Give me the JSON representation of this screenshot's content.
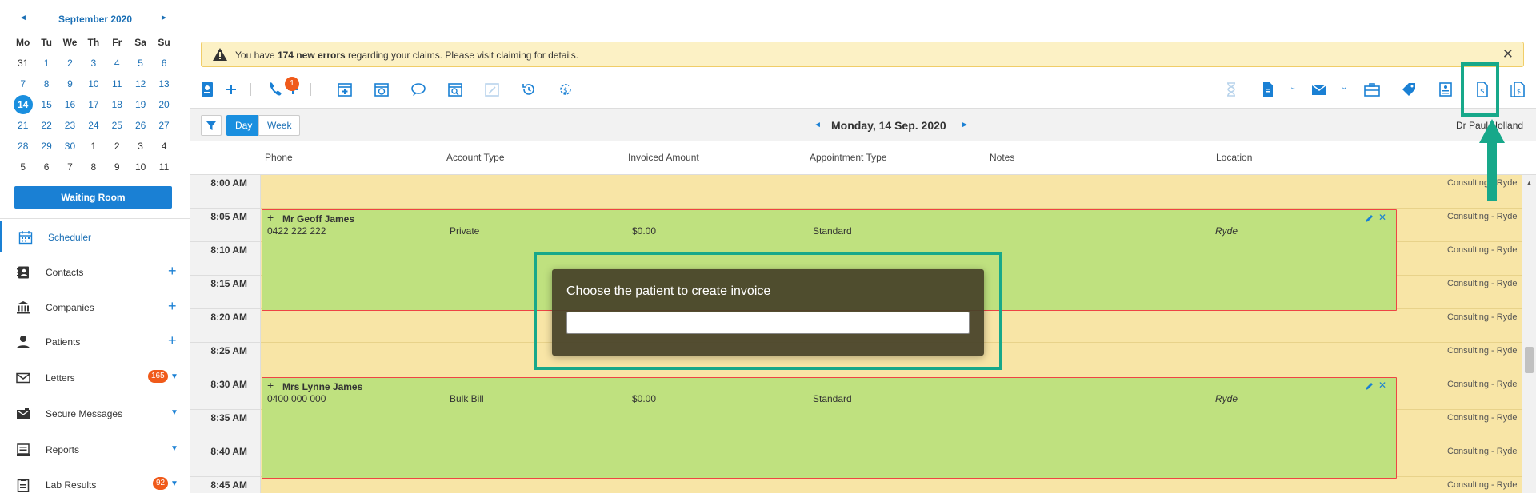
{
  "calendar": {
    "month_label": "September 2020",
    "prev": "◄",
    "next": "►",
    "weekdays": [
      "Mo",
      "Tu",
      "We",
      "Th",
      "Fr",
      "Sa",
      "Su"
    ],
    "weeks": [
      [
        "31",
        "1",
        "2",
        "3",
        "4",
        "5",
        "6"
      ],
      [
        "7",
        "8",
        "9",
        "10",
        "11",
        "12",
        "13"
      ],
      [
        "14",
        "15",
        "16",
        "17",
        "18",
        "19",
        "20"
      ],
      [
        "21",
        "22",
        "23",
        "24",
        "25",
        "26",
        "27"
      ],
      [
        "28",
        "29",
        "30",
        "1",
        "2",
        "3",
        "4"
      ],
      [
        "5",
        "6",
        "7",
        "8",
        "9",
        "10",
        "11"
      ]
    ],
    "selected_day": "14"
  },
  "waiting_room_label": "Waiting Room",
  "nav": [
    {
      "label": "Scheduler",
      "icon": "calendar-icon"
    },
    {
      "label": "Contacts",
      "icon": "contacts-icon",
      "plus": "+"
    },
    {
      "label": "Companies",
      "icon": "bank-icon",
      "plus": "+"
    },
    {
      "label": "Patients",
      "icon": "person-icon",
      "plus": "+"
    },
    {
      "label": "Letters",
      "icon": "envelope-icon",
      "badge": "165"
    },
    {
      "label": "Secure Messages",
      "icon": "secure-mail-icon"
    },
    {
      "label": "Reports",
      "icon": "reports-icon"
    },
    {
      "label": "Lab Results",
      "icon": "clipboard-icon",
      "badge": "92"
    }
  ],
  "alert": {
    "prefix": "You have ",
    "count_text": "174 new errors",
    "suffix": " regarding your claims. Please visit claiming for details.",
    "close": "✕"
  },
  "toolbar": {
    "phone_badge": "1",
    "add_plus": "+"
  },
  "day_header": {
    "day_label": "Day",
    "week_label": "Week",
    "date_title": "Monday, 14 Sep. 2020",
    "prev": "◄",
    "next": "►",
    "doctor": "Dr Paul Holland"
  },
  "columns": [
    "Phone",
    "Account Type",
    "Invoiced Amount",
    "Appointment Type",
    "Notes",
    "Location"
  ],
  "times": [
    "8:00 AM",
    "8:05 AM",
    "8:10 AM",
    "8:15 AM",
    "8:20 AM",
    "8:25 AM",
    "8:30 AM",
    "8:35 AM",
    "8:40 AM",
    "8:45 AM"
  ],
  "location_label": "Consulting - Ryde",
  "appointments": [
    {
      "name": "Mr Geoff James",
      "phone": "0422 222 222",
      "account": "Private",
      "invoiced": "$0.00",
      "type": "Standard",
      "location": "Ryde",
      "plus": "+",
      "delete": "✕"
    },
    {
      "name": "Mrs Lynne James",
      "phone": "0400 000 000",
      "account": "Bulk Bill",
      "invoiced": "$0.00",
      "type": "Standard",
      "location": "Ryde",
      "plus": "+",
      "delete": "✕"
    }
  ],
  "modal": {
    "title": "Choose the patient to create invoice",
    "input_value": ""
  },
  "colors": {
    "accent": "#1a80d4",
    "appointment": "#bfe17f",
    "slot": "#f8e5a6",
    "highlight": "#17a88a",
    "badge": "#f05a1a"
  }
}
